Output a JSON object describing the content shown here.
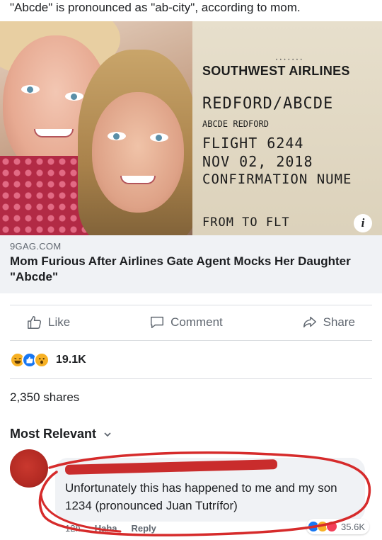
{
  "caption": "\"Abcde\" is pronounced as \"ab-city\", according to mom.",
  "link_preview": {
    "ticket": {
      "airline": "SOUTHWEST AIRLINES",
      "passenger": "REDFORD/ABCDE",
      "passenger_alt": "ABCDE REDFORD",
      "flight": "FLIGHT 6244",
      "date": "NOV 02, 2018",
      "confirmation": "CONFIRMATION NUME",
      "columns": "FROM TO   FLT"
    },
    "info_icon_text": "i",
    "source": "9GAG.COM",
    "title": "Mom Furious After Airlines Gate Agent Mocks Her Daughter \"Abcde\""
  },
  "actions": {
    "like": "Like",
    "comment": "Comment",
    "share": "Share"
  },
  "reactions": {
    "icons": [
      "haha-icon",
      "like-icon",
      "wow-icon"
    ],
    "count": "19.1K"
  },
  "shares": "2,350 shares",
  "sort": {
    "label": "Most Relevant"
  },
  "comment": {
    "text": "Unfortunately this has happened to me and my son 1234 (pronounced Juan Tutrífor)",
    "time": "12h",
    "haha": "Haha",
    "reply": "Reply",
    "reaction_icons": [
      "like-icon",
      "haha-icon",
      "love-icon"
    ],
    "reaction_count": "35.6K"
  },
  "colors": {
    "facebook_blue": "#1877f2",
    "reaction_yellow": "#f7b125",
    "love_red": "#f33e58",
    "annotation_red": "#d62b2b",
    "secondary_text": "#606770"
  }
}
